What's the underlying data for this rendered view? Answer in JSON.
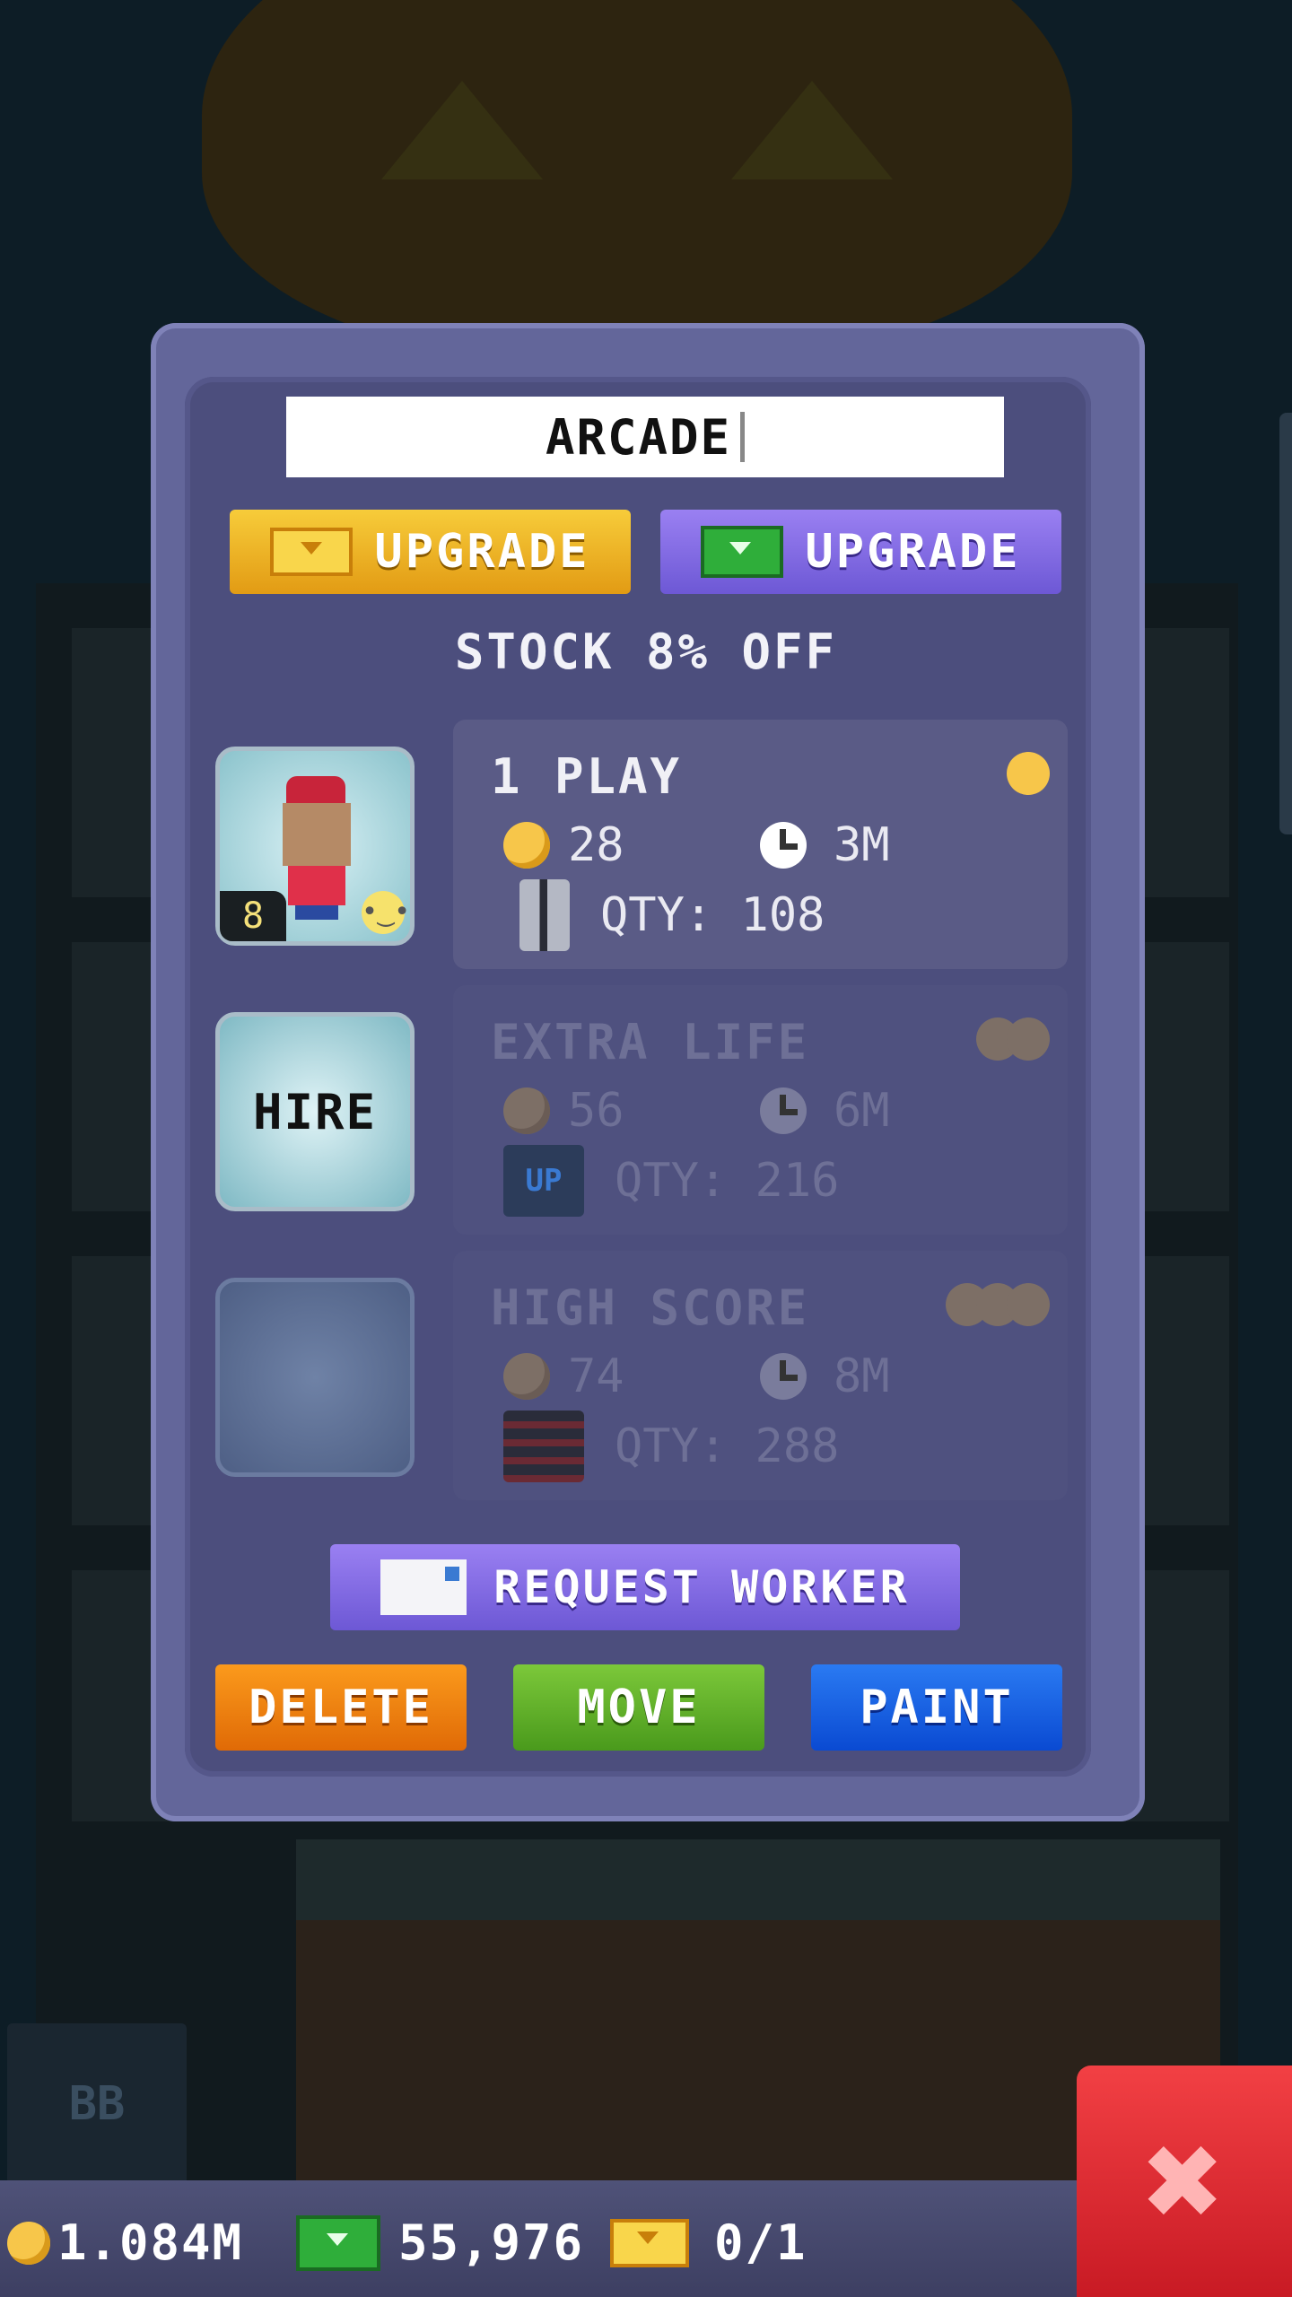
{
  "room": {
    "name": "ARCADE",
    "upgrade_coin_label": "UPGRADE",
    "upgrade_bux_label": "UPGRADE",
    "stock_discount": "STOCK 8% OFF"
  },
  "workers": {
    "slot1_level": "8",
    "slot2_label": "HIRE"
  },
  "products": [
    {
      "name": "1 PLAY",
      "cost": "28",
      "time": "3M",
      "qty": "QTY: 108",
      "state": "active"
    },
    {
      "name": "EXTRA LIFE",
      "cost": "56",
      "time": "6M",
      "qty": "QTY: 216",
      "state": "locked"
    },
    {
      "name": "HIGH SCORE",
      "cost": "74",
      "time": "8M",
      "qty": "QTY: 288",
      "state": "locked"
    }
  ],
  "icons": {
    "extra_life": "UP"
  },
  "actions": {
    "request_worker": "REQUEST WORKER",
    "delete": "DELETE",
    "move": "MOVE",
    "paint": "PAINT"
  },
  "status_bar": {
    "coins": "1.084M",
    "bux": "55,976",
    "vip": "0/1"
  },
  "colors": {
    "panel": "#63669a",
    "coin_upgrade": "#f7cc3a",
    "bux_upgrade": "#8a70e6",
    "delete": "#f58a10",
    "move": "#5aaa28",
    "paint": "#1a62e8",
    "close": "#e2303a"
  }
}
